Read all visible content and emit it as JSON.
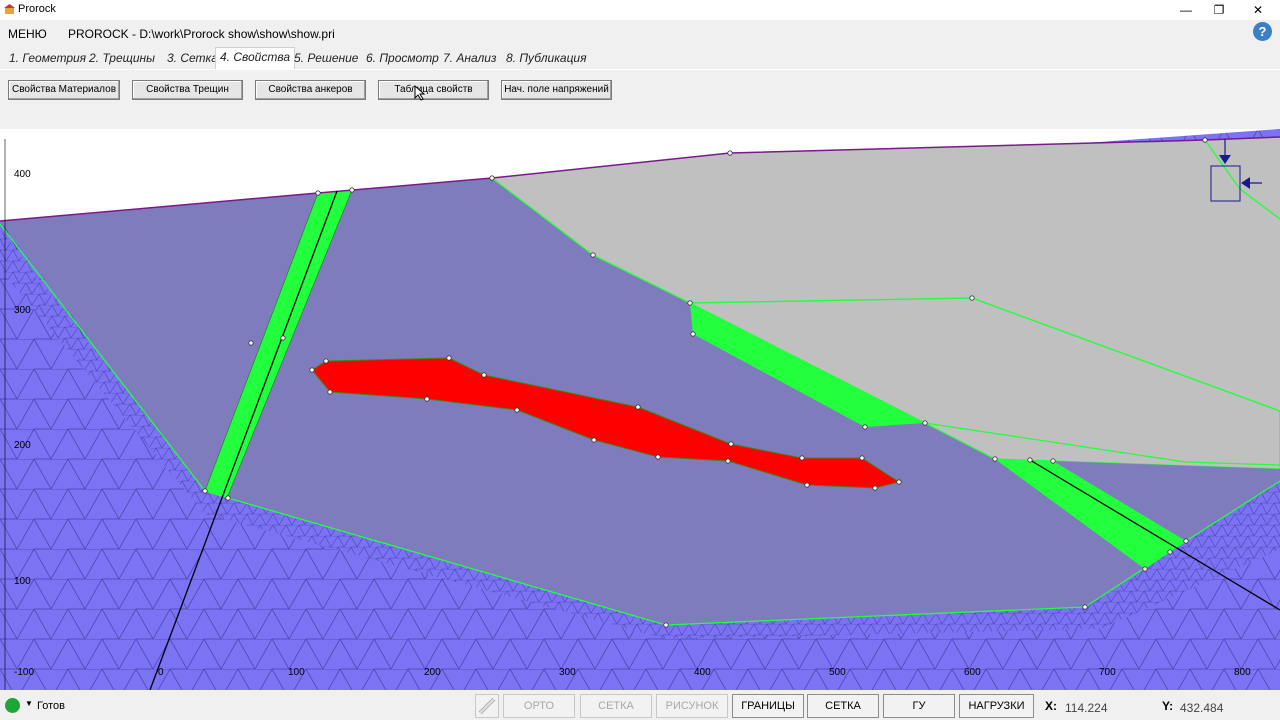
{
  "window": {
    "title": "Prorock",
    "minimize": "—",
    "maximize": "❐",
    "close": "✕"
  },
  "menubar": {
    "menu_label": "МЕНЮ",
    "project_path": "PROROCK - D:\\work\\Prorock show\\show\\show.pri",
    "help": "?"
  },
  "tabs": [
    {
      "label": "1. Геометрия"
    },
    {
      "label": "2. Трещины"
    },
    {
      "label": "3. Сетка"
    },
    {
      "label": "4. Свойства",
      "active": true
    },
    {
      "label": "5. Решение"
    },
    {
      "label": "6. Просмотр"
    },
    {
      "label": "7. Анализ"
    },
    {
      "label": "8. Публикация"
    }
  ],
  "toolbar": {
    "buttons": [
      {
        "label": "Свойства Материалов"
      },
      {
        "label": "Свойства Трещин"
      },
      {
        "label": "Свойства анкеров"
      },
      {
        "label": "Таблица свойств"
      },
      {
        "label": "Нач. поле напряжений"
      }
    ]
  },
  "canvas": {
    "y_ticks": [
      "400",
      "300",
      "200",
      "100",
      "-100"
    ],
    "x_ticks": [
      "-100",
      "0",
      "100",
      "200",
      "300",
      "400",
      "500",
      "600",
      "700",
      "800"
    ],
    "colors": {
      "mesh_bg": "#7b72f4",
      "rock_mass": "#7f7cbe",
      "upper_block": "#c0c0c0",
      "fracture_zone": "#22ff3c",
      "inclusion": "#ff0000",
      "surface_line": "#7a1a8a"
    }
  },
  "status": {
    "state": "Готов",
    "buttons": [
      {
        "label": "ОРТО",
        "enabled": false
      },
      {
        "label": "СЕТКА",
        "enabled": false
      },
      {
        "label": "РИСУНОК",
        "enabled": false
      },
      {
        "label": "ГРАНИЦЫ",
        "enabled": true
      },
      {
        "label": "СЕТКА",
        "enabled": true
      },
      {
        "label": "ГУ",
        "enabled": true
      },
      {
        "label": "НАГРУЗКИ",
        "enabled": true
      }
    ],
    "x_label": "X:",
    "x_value": "114.224",
    "y_label": "Y:",
    "y_value": "432.484"
  }
}
